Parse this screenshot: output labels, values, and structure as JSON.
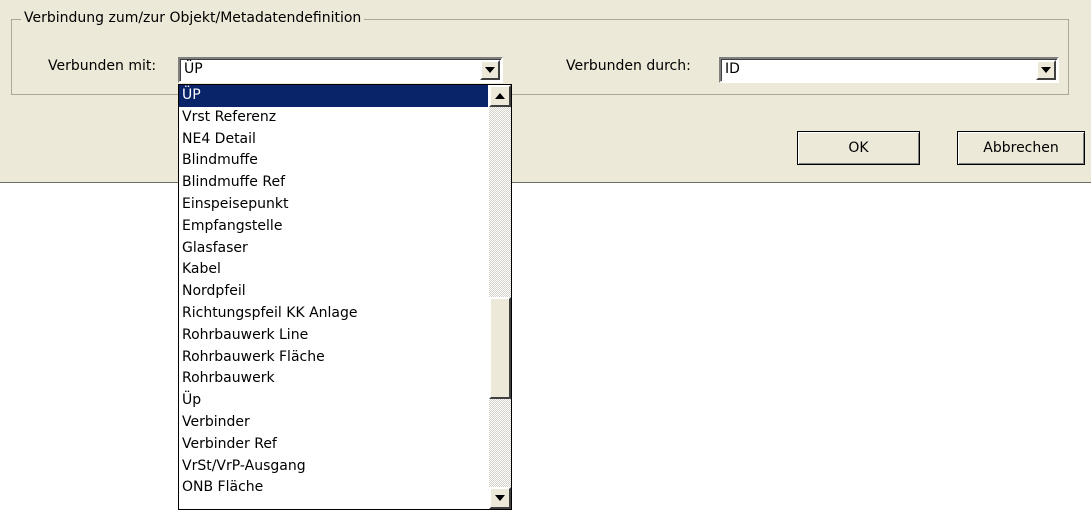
{
  "group": {
    "legend": "Verbindung zum/zur Objekt/Metadatendefinition"
  },
  "connected_with": {
    "label": "Verbunden mit:",
    "value": "ÜP"
  },
  "connected_by": {
    "label": "Verbunden durch:",
    "value": "ID"
  },
  "buttons": {
    "ok": "OK",
    "cancel": "Abbrechen"
  },
  "dropdown": {
    "selected_index": 0,
    "items": [
      "ÜP",
      "Vrst Referenz",
      "NE4 Detail",
      "Blindmuffe",
      "Blindmuffe Ref",
      "Einspeisepunkt",
      "Empfangstelle",
      "Glasfaser",
      "Kabel",
      "Nordpfeil",
      "Richtungspfeil KK Anlage",
      "Rohrbauwerk Line",
      "Rohrbauwerk Fläche",
      "Rohrbauwerk",
      "Üp",
      "Verbinder",
      "Verbinder Ref",
      "VrSt/VrP-Ausgang",
      "ONB Fläche"
    ]
  },
  "icons": {
    "dropdown_arrow": "chevron-down-icon",
    "scroll_up": "arrow-up-icon",
    "scroll_down": "arrow-down-icon"
  },
  "colors": {
    "dialog_bg": "#ece9d8",
    "selection_bg": "#0a246a",
    "selection_fg": "#ffffff"
  }
}
